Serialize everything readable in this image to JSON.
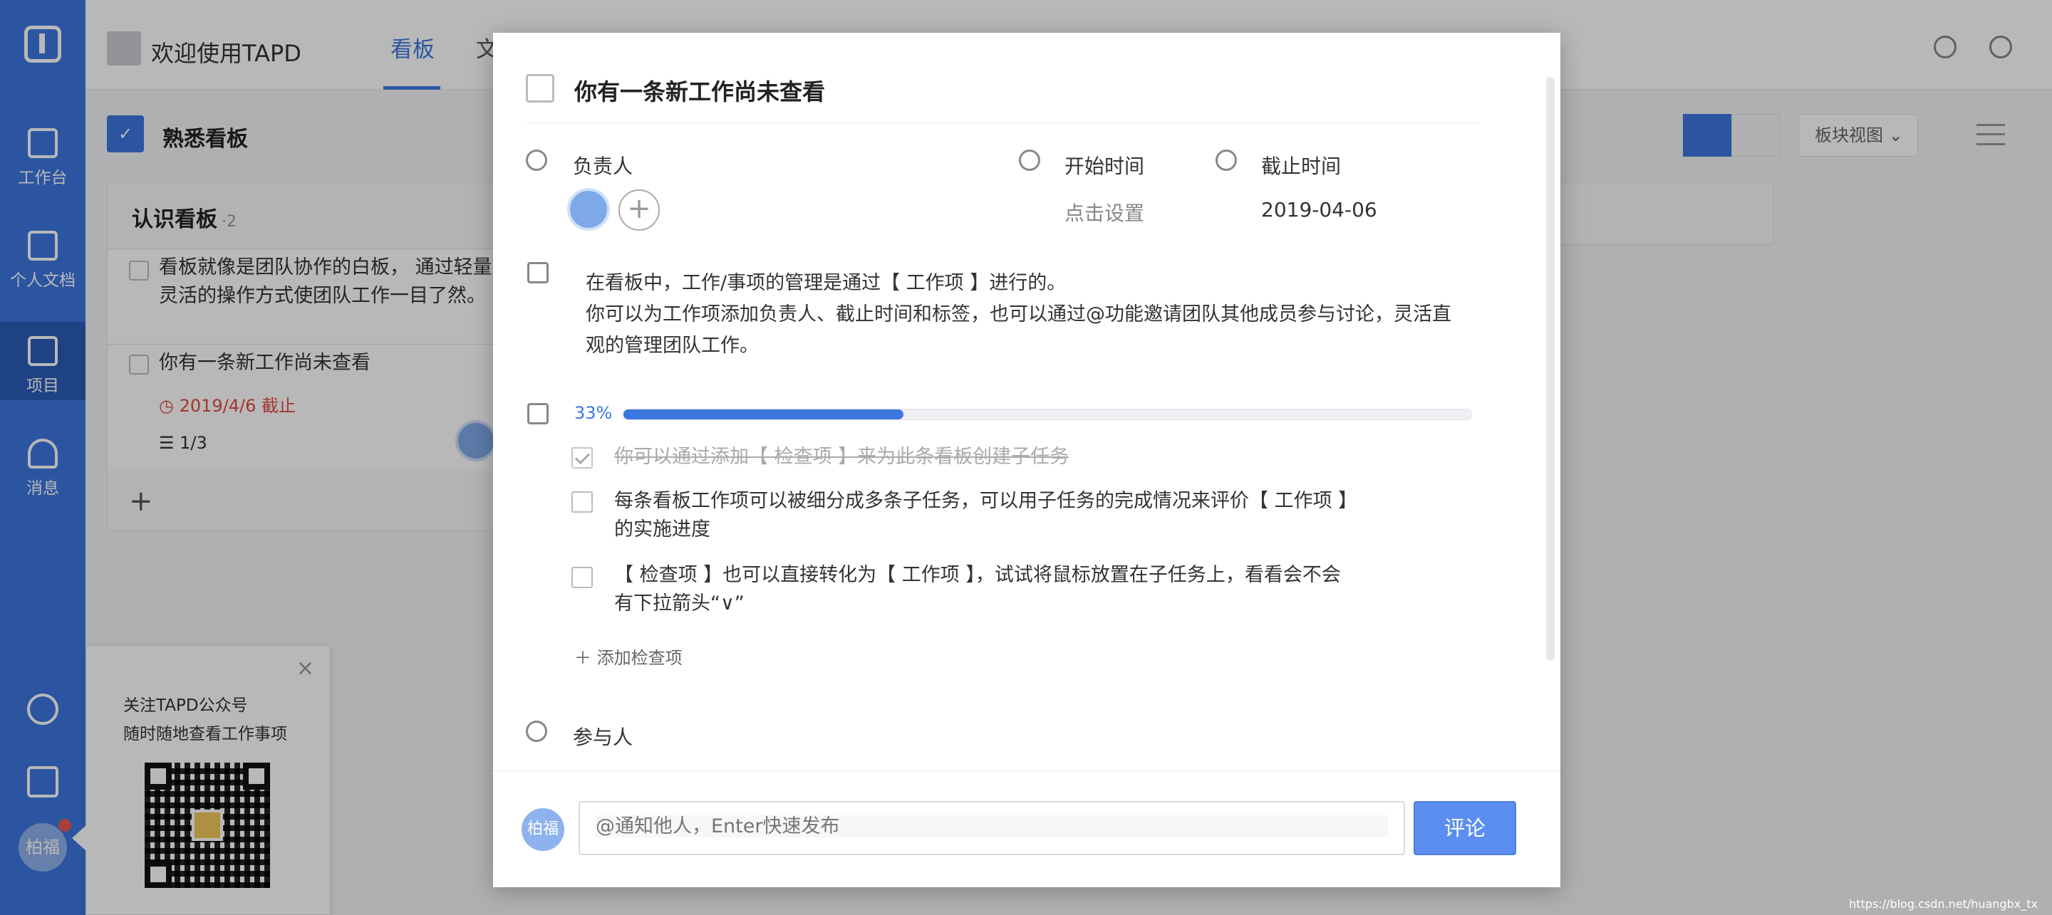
{
  "sidebar": {
    "items": [
      {
        "label": "工作台",
        "icon": "archive-icon"
      },
      {
        "label": "个人文档",
        "icon": "document-icon"
      },
      {
        "label": "项目",
        "icon": "inbox-icon"
      },
      {
        "label": "消息",
        "icon": "bell-icon"
      }
    ],
    "avatar_text": "柏福"
  },
  "header": {
    "project_name": "欢迎使用TAPD",
    "tabs": [
      "看板",
      "文"
    ]
  },
  "board": {
    "title": "熟悉看板",
    "view_select": "板块视图",
    "column": {
      "title": "认识看板",
      "count": "·2",
      "cards": [
        {
          "text": "看板就像是团队协作的白板， 通过轻量灵活的操作方式使团队工作一目了然。"
        },
        {
          "text": "你有一条新工作尚未查看",
          "due": "2019/4/6 截止",
          "subtasks": "1/3"
        }
      ]
    }
  },
  "promo": {
    "line1": "关注TAPD公众号",
    "line2": "随时随地查看工作事项"
  },
  "modal": {
    "title": "你有一条新工作尚未查看",
    "assignee_label": "负责人",
    "start_label": "开始时间",
    "start_value": "点击设置",
    "due_label": "截止时间",
    "due_value": "2019-04-06",
    "description_line1": "在看板中，工作/事项的管理是通过【 工作项 】进行的。",
    "description_line2": "你可以为工作项添加负责人、截止时间和标签，也可以通过@功能邀请团队其他成员参与讨论，灵活直观的管理团队工作。",
    "progress_text": "33%",
    "progress_fraction": 0.33,
    "checklist": [
      {
        "text": "你可以通过添加【 检查项 】来为此条看板创建子任务",
        "done": true
      },
      {
        "text": "每条看板工作项可以被细分成多条子任务，可以用子任务的完成情况来评价【 工作项 】的实施进度",
        "done": false
      },
      {
        "text": "【 检查项 】也可以直接转化为【 工作项 】，试试将鼠标放置在子任务上，看看会不会有下拉箭头“∨”",
        "done": false
      }
    ],
    "add_checklist": "添加检查项",
    "participants_label": "参与人",
    "comment_avatar": "柏福",
    "comment_placeholder": "@通知他人，Enter快速发布",
    "comment_button": "评论"
  },
  "watermark": "https://blog.csdn.net/huangbx_tx"
}
